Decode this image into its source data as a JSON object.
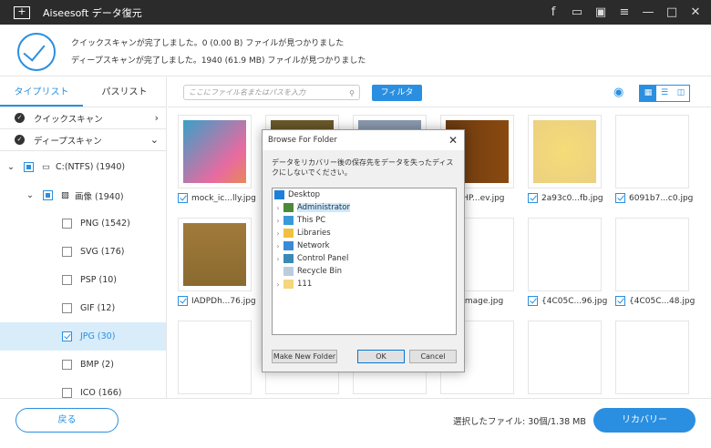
{
  "app": {
    "title": "Aiseesoft データ復元",
    "titlebar_icons": [
      "facebook-icon",
      "feedback-icon",
      "save-icon",
      "menu-icon",
      "minimize-icon",
      "maximize-icon",
      "close-icon"
    ]
  },
  "scan": {
    "quick": "クイックスキャンが完了しました。0 (0.00  B) ファイルが見つかりました",
    "deep": "ディープスキャンが完了しました。1940 (61.9 MB) ファイルが見つかりました"
  },
  "sidebar": {
    "tabs": [
      "タイプリスト",
      "パスリスト"
    ],
    "quick_scan": "クイックスキャン",
    "deep_scan": "ディープスキャン",
    "drive": "C:(NTFS) (1940)",
    "image_group": "画像 (1940)",
    "types": [
      {
        "label": "PNG (1542)",
        "checked": false
      },
      {
        "label": "SVG (176)",
        "checked": false
      },
      {
        "label": "PSP (10)",
        "checked": false
      },
      {
        "label": "GIF (12)",
        "checked": false
      },
      {
        "label": "JPG (30)",
        "checked": true
      },
      {
        "label": "BMP (2)",
        "checked": false
      },
      {
        "label": "ICO (166)",
        "checked": false
      }
    ]
  },
  "toolbar": {
    "search_placeholder": "ここにファイル名またはパスを入力",
    "filter": "フィルタ"
  },
  "files": [
    {
      "name": "mock_ic...lly.jpg",
      "color": "linear-gradient(135deg,#3aa0c8,#e86aa0 70%,#e8885a)"
    },
    {
      "name": "",
      "color": "linear-gradient(#6b5a2a,#5a4a20)"
    },
    {
      "name": "",
      "color": "linear-gradient(#8a9ab0,#a0a8b8)"
    },
    {
      "name": "s_HP...ev.jpg",
      "color": "linear-gradient(90deg,#6b3a10,#8a4a10)"
    },
    {
      "name": "2a93c0...fb.jpg",
      "color": "radial-gradient(#f5dc78,#ecd080)"
    },
    {
      "name": "6091b7...c0.jpg",
      "color": "#fff"
    },
    {
      "name": "IADPDh...76.jpg",
      "color": "linear-gradient(#a07a3a,#8a6a30)"
    },
    {
      "name": "",
      "color": "#fff"
    },
    {
      "name": "",
      "color": "#fff"
    },
    {
      "name": "erImage.jpg",
      "color": "#fff"
    },
    {
      "name": "{4C05C...96.jpg",
      "color": "#fff"
    },
    {
      "name": "{4C05C...48.jpg",
      "color": "#fff"
    },
    {
      "name": "",
      "color": "#fff"
    },
    {
      "name": "",
      "color": "#fff"
    },
    {
      "name": "",
      "color": "#fff"
    },
    {
      "name": "",
      "color": "#fff"
    },
    {
      "name": "",
      "color": "#fff"
    },
    {
      "name": "",
      "color": "#fff"
    }
  ],
  "footer": {
    "back": "戻る",
    "selected": "選択したファイル: 30個/1.38 MB",
    "recover": "リカバリー"
  },
  "dialog": {
    "title": "Browse For Folder",
    "message": "データをリカバリー後の保存先をデータを失ったディスクにしないでください。",
    "items": [
      {
        "label": "Desktop",
        "arrow": false,
        "root": true
      },
      {
        "label": "Administrator",
        "arrow": true
      },
      {
        "label": "This PC",
        "arrow": true
      },
      {
        "label": "Libraries",
        "arrow": true
      },
      {
        "label": "Network",
        "arrow": true
      },
      {
        "label": "Control Panel",
        "arrow": true
      },
      {
        "label": "Recycle Bin",
        "arrow": false
      },
      {
        "label": "111",
        "arrow": true
      }
    ],
    "make_folder": "Make New Folder",
    "ok": "OK",
    "cancel": "Cancel"
  },
  "colors": {
    "accent": "#2a8fe0",
    "titlebar": "#2b2b2b"
  }
}
